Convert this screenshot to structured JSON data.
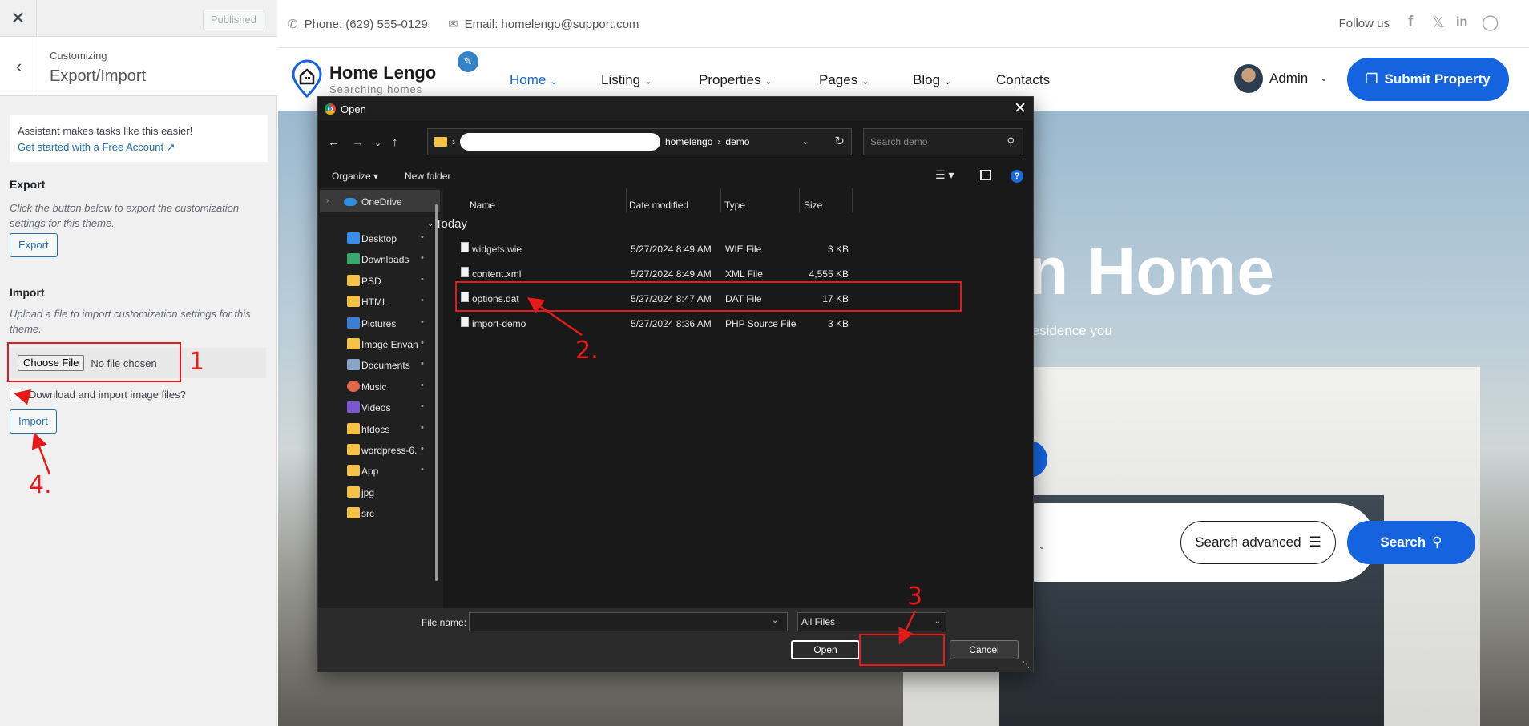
{
  "sidebar": {
    "close_icon": "close-icon",
    "published_label": "Published",
    "back_icon": "chevron-left-icon",
    "customizing_label": "Customizing",
    "section_title": "Export/Import",
    "notice": {
      "text": "Assistant makes tasks like this easier!",
      "link": "Get started with a Free Account"
    },
    "export": {
      "heading": "Export",
      "description": "Click the button below to export the customization settings for this theme.",
      "button": "Export"
    },
    "import": {
      "heading": "Import",
      "description": "Upload a file to import customization settings for this theme.",
      "choose_file": "Choose File",
      "no_file": "No file chosen",
      "checkbox_label": "Download and import image files?",
      "button": "Import"
    }
  },
  "annotations": {
    "label_1": "1",
    "label_2": "2.",
    "label_3": "3",
    "label_4": "4.",
    "color": "#e31b1b"
  },
  "site": {
    "phone": "Phone: (629) 555-0129",
    "email": "Email: homelengo@support.com",
    "follow_us": "Follow us",
    "social_icons": [
      "facebook-icon",
      "x-icon",
      "linkedin-icon",
      "instagram-icon"
    ],
    "brand_name": "Home Lengo",
    "brand_tagline": "Searching homes",
    "nav": [
      {
        "label": "Home"
      },
      {
        "label": "Listing"
      },
      {
        "label": "Properties"
      },
      {
        "label": "Pages"
      },
      {
        "label": "Blog"
      },
      {
        "label": "Contacts"
      }
    ],
    "admin_name": "Admin",
    "submit_button": "Submit Property",
    "hero_title": "n Home",
    "hero_subtitle": "residence you",
    "search_advanced": "Search advanced",
    "search_button": "Search",
    "accent_color": "#1563df"
  },
  "dialog": {
    "title": "Open",
    "address": {
      "segment_1": "homelengo",
      "separator": "›",
      "segment_2": "demo"
    },
    "search_placeholder": "Search demo",
    "organize": "Organize",
    "new_folder": "New folder",
    "help": "?",
    "nav_items": [
      {
        "label": "OneDrive",
        "icon": "onedrive-icon",
        "pinned": false
      },
      {
        "label": "Desktop",
        "icon": "desktop-icon",
        "pinned": true
      },
      {
        "label": "Downloads",
        "icon": "download-icon",
        "pinned": true
      },
      {
        "label": "PSD",
        "icon": "folder-icon",
        "pinned": true
      },
      {
        "label": "HTML",
        "icon": "folder-icon",
        "pinned": true
      },
      {
        "label": "Pictures",
        "icon": "pictures-icon",
        "pinned": true
      },
      {
        "label": "Image Envan",
        "icon": "folder-icon",
        "pinned": true
      },
      {
        "label": "Documents",
        "icon": "documents-icon",
        "pinned": true
      },
      {
        "label": "Music",
        "icon": "music-icon",
        "pinned": true
      },
      {
        "label": "Videos",
        "icon": "videos-icon",
        "pinned": true
      },
      {
        "label": "htdocs",
        "icon": "folder-icon",
        "pinned": true
      },
      {
        "label": "wordpress-6.",
        "icon": "folder-icon",
        "pinned": true
      },
      {
        "label": "App",
        "icon": "folder-icon",
        "pinned": true
      },
      {
        "label": "jpg",
        "icon": "folder-icon",
        "pinned": false
      },
      {
        "label": "src",
        "icon": "folder-icon",
        "pinned": false
      }
    ],
    "columns": {
      "name": "Name",
      "date": "Date modified",
      "type": "Type",
      "size": "Size"
    },
    "group": "Today",
    "files": [
      {
        "name": "widgets.wie",
        "date": "5/27/2024 8:49 AM",
        "type": "WIE File",
        "size": "3 KB"
      },
      {
        "name": "content.xml",
        "date": "5/27/2024 8:49 AM",
        "type": "XML File",
        "size": "4,555 KB"
      },
      {
        "name": "options.dat",
        "date": "5/27/2024 8:47 AM",
        "type": "DAT File",
        "size": "17 KB"
      },
      {
        "name": "import-demo",
        "date": "5/27/2024 8:36 AM",
        "type": "PHP Source File",
        "size": "3 KB"
      }
    ],
    "file_name_label": "File name:",
    "file_name_value": "",
    "file_type": "All Files",
    "open_button": "Open",
    "cancel_button": "Cancel"
  }
}
